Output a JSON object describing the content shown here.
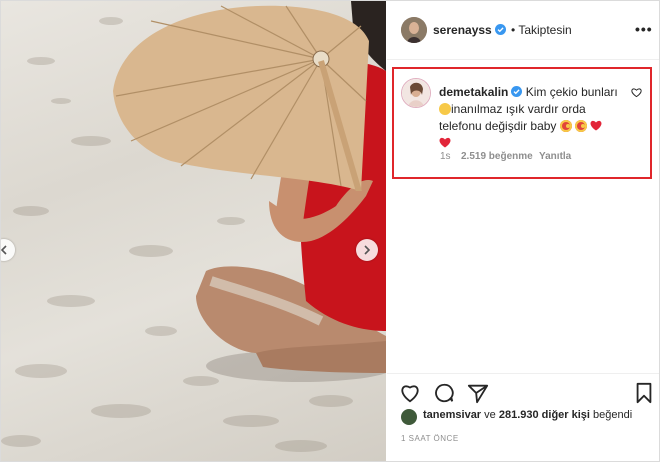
{
  "post_header": {
    "username": "serenayss",
    "separator": "•",
    "follow_status": "Takiptesin",
    "more_icon": "more-dots-icon"
  },
  "highlighted_comment": {
    "username": "demetakalin",
    "line1": "Kim çekio bunları",
    "line2": "inanılmaz ışık vardır orda",
    "line3": "telefonu değişdir baby",
    "time": "1s",
    "likes": "2.519 beğenme",
    "reply": "Yanıtla",
    "highlight_color": "#e0262b"
  },
  "actions": {
    "like_icon": "heart-icon",
    "comment_icon": "comment-bubble-icon",
    "share_icon": "paper-plane-icon",
    "save_icon": "bookmark-icon"
  },
  "likes_summary": {
    "user": "tanemsivar",
    "connector": "ve",
    "others": "281.930 diğer kişi",
    "suffix": "beğendi"
  },
  "timestamp": "1 SAAT ÖNCE",
  "colors": {
    "verified": "#3897f0",
    "meta_gray": "#8e8e8e",
    "heart_red": "#ed4956",
    "swimsuit": "#c8141c"
  }
}
